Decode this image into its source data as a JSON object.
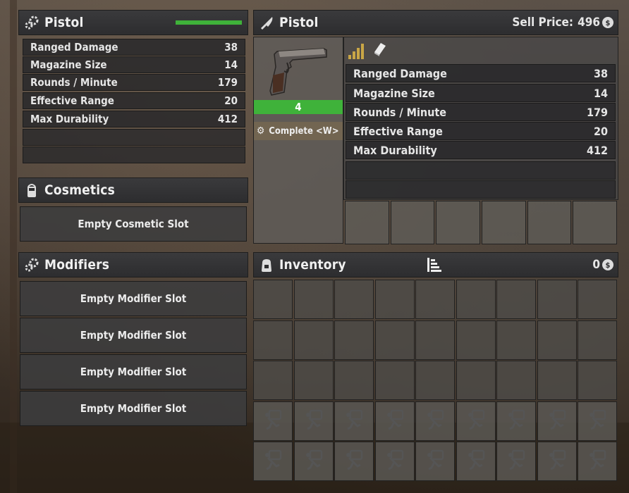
{
  "item_stats": {
    "title": "Pistol",
    "rows": [
      {
        "label": "Ranged Damage",
        "value": "38"
      },
      {
        "label": "Magazine Size",
        "value": "14"
      },
      {
        "label": "Rounds / Minute",
        "value": "179"
      },
      {
        "label": "Effective Range",
        "value": "20"
      },
      {
        "label": "Max Durability",
        "value": "412"
      }
    ]
  },
  "cosmetics": {
    "title": "Cosmetics",
    "slot_label": "Empty Cosmetic Slot"
  },
  "modifiers": {
    "title": "Modifiers",
    "slots": [
      "Empty Modifier Slot",
      "Empty Modifier Slot",
      "Empty Modifier Slot",
      "Empty Modifier Slot"
    ]
  },
  "item_info": {
    "title": "Pistol",
    "sell_price_label": "Sell Price:",
    "sell_price_value": "496",
    "quality": "4",
    "quality_color": "#3fb23a",
    "complete_label": "Complete <W>",
    "rows": [
      {
        "label": "Ranged Damage",
        "value": "38"
      },
      {
        "label": "Magazine Size",
        "value": "14"
      },
      {
        "label": "Rounds / Minute",
        "value": "179"
      },
      {
        "label": "Effective Range",
        "value": "20"
      },
      {
        "label": "Max Durability",
        "value": "412"
      }
    ]
  },
  "inventory": {
    "title": "Inventory",
    "coins": "0"
  },
  "colors": {
    "durability_bar": "#3fb23a",
    "quality_icon": "#c9a646"
  },
  "icons": [
    "gear-icon",
    "knife-icon",
    "coin-icon",
    "paint-bucket-icon",
    "backpack-icon",
    "sort-icon",
    "signal-bars-icon",
    "book-icon",
    "locked-slot-icon"
  ]
}
